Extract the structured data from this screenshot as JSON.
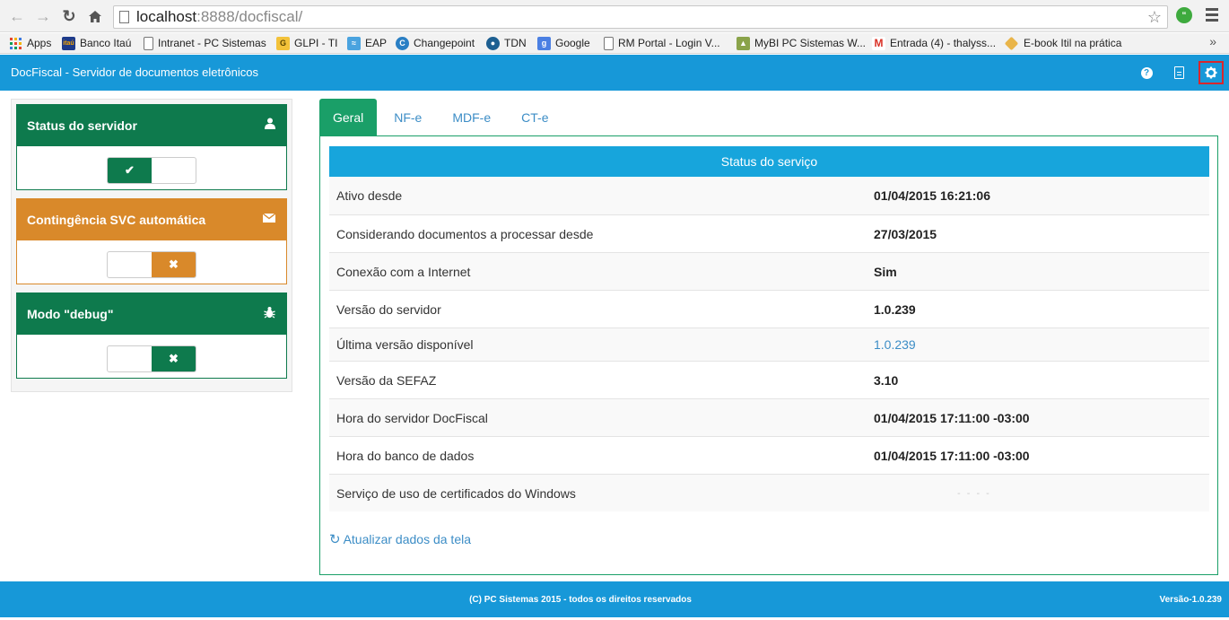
{
  "browser": {
    "url_host": "localhost",
    "url_path": ":8888/docfiscal/",
    "bookmarks": [
      {
        "label": "Apps",
        "icon": "apps-grid-icon"
      },
      {
        "label": "Banco Itaú",
        "icon": "itau-icon"
      },
      {
        "label": "Intranet - PC Sistemas",
        "icon": "page-icon"
      },
      {
        "label": "GLPI - TI",
        "icon": "glpi-icon"
      },
      {
        "label": "EAP",
        "icon": "eap-icon"
      },
      {
        "label": "Changepoint",
        "icon": "changepoint-icon"
      },
      {
        "label": "TDN",
        "icon": "tdn-icon"
      },
      {
        "label": "Google",
        "icon": "google-icon"
      },
      {
        "label": "RM Portal - Login V...",
        "icon": "page-icon"
      },
      {
        "label": "MyBI PC Sistemas W...",
        "icon": "mybi-icon"
      },
      {
        "label": "Entrada (4) - thalyss...",
        "icon": "gmail-icon"
      },
      {
        "label": "E-book Itil na prática",
        "icon": "ebook-icon"
      }
    ],
    "more_label": "»"
  },
  "app": {
    "title": "DocFiscal - Servidor de documentos eletrônicos"
  },
  "cards": {
    "server_status": {
      "title": "Status do servidor",
      "icon": "user-icon",
      "state": "on"
    },
    "contingency": {
      "title": "Contingência SVC automática",
      "icon": "envelope-icon",
      "state": "off"
    },
    "debug": {
      "title": "Modo \"debug\"",
      "icon": "bug-icon",
      "state": "off"
    }
  },
  "tabs": [
    "Geral",
    "NF-e",
    "MDF-e",
    "CT-e"
  ],
  "status": {
    "header": "Status do serviço",
    "rows": [
      {
        "label": "Ativo desde",
        "value": "01/04/2015 16:21:06"
      },
      {
        "label": "Considerando documentos a processar desde",
        "value": "27/03/2015"
      },
      {
        "label": "Conexão com a Internet",
        "value": "Sim"
      },
      {
        "label": "Versão do servidor",
        "value": "1.0.239"
      },
      {
        "label": "Última versão disponível",
        "value": "1.0.239"
      },
      {
        "label": "Versão da SEFAZ",
        "value": "3.10"
      },
      {
        "label": "Hora do servidor DocFiscal",
        "value": "01/04/2015 17:11:00 -03:00"
      },
      {
        "label": "Hora do banco de dados",
        "value": "01/04/2015 17:11:00 -03:00"
      },
      {
        "label": "Serviço de uso de certificados do Windows",
        "value": "- - - -"
      }
    ],
    "refresh_label": "Atualizar dados da tela"
  },
  "footer": {
    "copyright": "(C) PC Sistemas 2015 - todos os direitos reservados",
    "version": "Versão-1.0.239"
  },
  "colors": {
    "brand_blue": "#1798d8",
    "green": "#0e7a4d",
    "orange": "#d9892a",
    "tab_green": "#1a9f68",
    "link": "#3c8dc6"
  }
}
